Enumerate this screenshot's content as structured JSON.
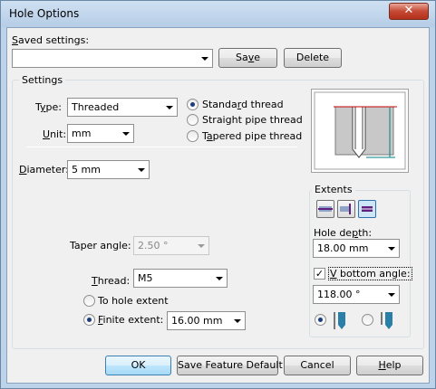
{
  "window": {
    "title": "Hole Options",
    "close_glyph": "✕"
  },
  "saved_settings": {
    "label": "Saved settings:",
    "value": "",
    "save_label": "Save",
    "delete_label": "Delete"
  },
  "settings": {
    "group_title": "Settings",
    "type_label": "Type:",
    "type_value": "Threaded",
    "unit_label": "Unit:",
    "unit_value": "mm",
    "thread_options": [
      "Standard thread",
      "Straight pipe thread",
      "Tapered pipe thread"
    ],
    "selected_thread_option": "Standard thread",
    "diameter_label": "Diameter:",
    "diameter_value": "5 mm",
    "taper_angle_label": "Taper angle:",
    "taper_angle_value": "2.50 °",
    "thread_label": "Thread:",
    "thread_value": "M5",
    "to_hole_extent_label": "To hole extent",
    "finite_extent_label": "Finite extent:",
    "finite_extent_value": "16.00 mm",
    "selected_extent_mode": "Finite extent"
  },
  "extents": {
    "group_title": "Extents",
    "hole_depth_label": "Hole depth:",
    "hole_depth_value": "18.00 mm",
    "v_bottom_label": "V bottom angle:",
    "v_bottom_checked": true,
    "v_bottom_value": "118.00 °",
    "depth_icons": [
      "depth-to-tip-icon",
      "depth-to-shoulder-icon"
    ],
    "selected_depth_icon": "depth-to-tip-icon",
    "extent_icons": [
      "extent-through-icon",
      "extent-to-face-icon",
      "extent-blind-icon"
    ],
    "selected_extent_icon": "extent-blind-icon"
  },
  "buttons": {
    "ok": "OK",
    "save_default": "Save Feature Default",
    "cancel": "Cancel",
    "help": "Help"
  },
  "colors": {
    "title_bg": "#bcd3ea",
    "close_red": "#c54934",
    "ok_blue": "#bee6fd",
    "preview_red": "#c00000",
    "preview_teal": "#008080"
  }
}
